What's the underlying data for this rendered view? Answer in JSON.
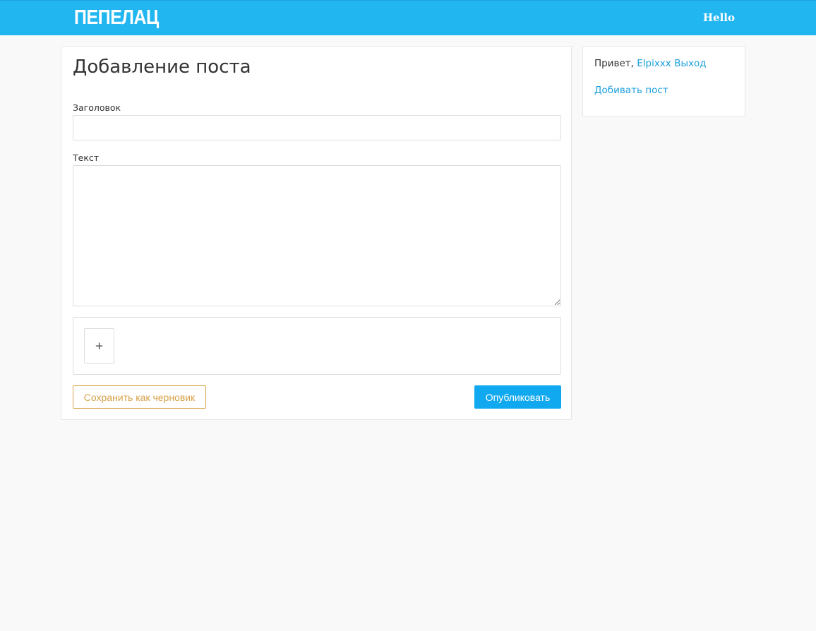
{
  "header": {
    "logo": "ПЕПЕЛАЦ",
    "greeting": "Hello"
  },
  "form": {
    "title": "Добавление поста",
    "title_label": "Заголовок",
    "title_value": "",
    "text_label": "Текст",
    "text_value": "",
    "add_attachment_label": "+",
    "save_draft_label": "Сохранить как черновик",
    "publish_label": "Опубликовать"
  },
  "sidebar": {
    "hello_prefix": "Привет,",
    "username": "Elpixxx",
    "logout": "Выход",
    "add_post": "Добивать пост"
  },
  "colors": {
    "header_bg": "#22b6f1",
    "link": "#1a9fdc",
    "publish_bg": "#10a9ef",
    "draft_accent": "#d9a24a",
    "page_bg": "#f9f9f9"
  }
}
